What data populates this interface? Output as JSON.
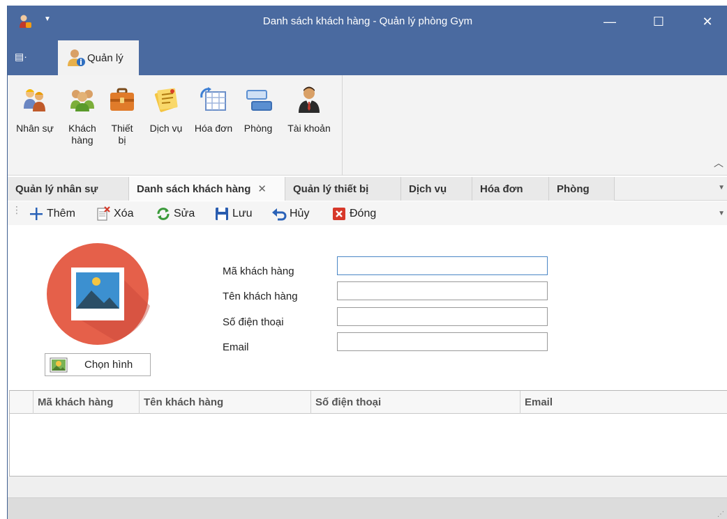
{
  "window": {
    "title": "Danh sách khách hàng - Quản lý phòng Gym",
    "minimize_glyph": "—",
    "maximize_glyph": "☐",
    "close_glyph": "✕",
    "app_icon": "user-menu-icon"
  },
  "ribbon": {
    "app_menu_glyph": "▤·",
    "active_tab": "Quản lý",
    "buttons": [
      {
        "label": "Nhân sự",
        "icon": "workers-icon"
      },
      {
        "label": "Khách hàng",
        "icon": "customers-icon"
      },
      {
        "label": "Thiết bị",
        "icon": "briefcase-icon"
      },
      {
        "label": "Dịch vụ",
        "icon": "notes-icon"
      },
      {
        "label": "Hóa đơn",
        "icon": "invoice-table-icon"
      },
      {
        "label": "Phòng",
        "icon": "room-panels-icon"
      },
      {
        "label": "Tài khoản",
        "icon": "account-icon"
      }
    ]
  },
  "doc_tabs": [
    {
      "label": "Quản lý nhân sự"
    },
    {
      "label": "Danh sách khách hàng",
      "active": true
    },
    {
      "label": "Quản lý thiết bị"
    },
    {
      "label": "Dịch vụ"
    },
    {
      "label": "Hóa đơn"
    },
    {
      "label": "Phòng"
    }
  ],
  "toolbar": {
    "add": "Thêm",
    "delete": "Xóa",
    "edit": "Sửa",
    "save": "Lưu",
    "cancel": "Hủy",
    "close": "Đóng"
  },
  "form": {
    "choose_image": "Chọn hình",
    "fields": [
      {
        "label": "Mã khách hàng",
        "value": ""
      },
      {
        "label": "Tên khách hàng",
        "value": ""
      },
      {
        "label": "Số điện thoại",
        "value": ""
      },
      {
        "label": "Email",
        "value": ""
      }
    ]
  },
  "grid": {
    "columns": [
      "Mã khách hàng",
      "Tên khách hàng",
      "Số điện thoại",
      "Email"
    ],
    "rows": []
  },
  "colors": {
    "title_bar": "#4a6aa0",
    "ribbon_body": "#f3f3f3",
    "avatar_circle": "#e5604a",
    "focus_border": "#4a86c5"
  }
}
